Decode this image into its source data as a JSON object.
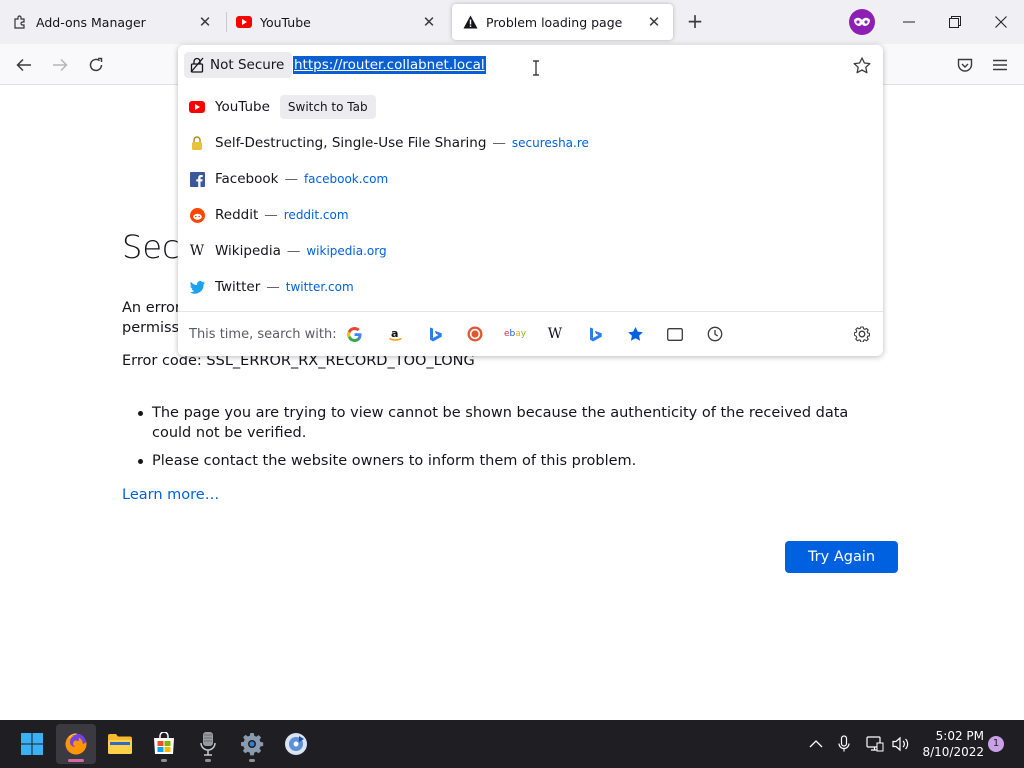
{
  "tabs": [
    {
      "title": "Add-ons Manager",
      "icon": "puzzle-icon",
      "active": false
    },
    {
      "title": "YouTube",
      "icon": "youtube-icon",
      "active": false
    },
    {
      "title": "Problem loading page",
      "icon": "warning-icon",
      "active": true
    }
  ],
  "urlbar": {
    "security_label": "Not Secure",
    "url": "https://router.collabnet.local"
  },
  "suggestions": [
    {
      "title": "YouTube",
      "action": "Switch to Tab",
      "url": "",
      "icon": "youtube-icon"
    },
    {
      "title": "Self-Destructing, Single-Use File Sharing",
      "url": "securesha.re",
      "icon": "lock-icon"
    },
    {
      "title": "Facebook",
      "url": "facebook.com",
      "icon": "facebook-icon"
    },
    {
      "title": "Reddit",
      "url": "reddit.com",
      "icon": "reddit-icon"
    },
    {
      "title": "Wikipedia",
      "url": "wikipedia.org",
      "icon": "wikipedia-icon"
    },
    {
      "title": "Twitter",
      "url": "twitter.com",
      "icon": "twitter-icon"
    }
  ],
  "search_with_label": "This time, search with:",
  "search_engines": [
    "google-icon",
    "amazon-icon",
    "bing-icon",
    "duckduckgo-icon",
    "ebay-icon",
    "wikipedia-icon",
    "bing-icon",
    "bookmarks-icon",
    "tabs-icon",
    "history-icon"
  ],
  "dash": "—",
  "error": {
    "title_visible": "Secu",
    "desc_line1": "An error",
    "desc_line2": "permissi",
    "code": "Error code: SSL_ERROR_RX_RECORD_TOO_LONG",
    "bullets": [
      "The page you are trying to view cannot be shown because the authenticity of the received data could not be verified.",
      "Please contact the website owners to inform them of this problem."
    ],
    "learn_more": "Learn more…",
    "try_again": "Try Again"
  },
  "taskbar": {
    "apps": [
      "windows-start-icon",
      "firefox-icon",
      "file-explorer-icon",
      "microsoft-store-icon",
      "microphone-app-icon",
      "settings-icon",
      "media-player-icon"
    ],
    "time": "5:02 PM",
    "date": "8/10/2022",
    "notifications": "1"
  },
  "colors": {
    "accent": "#0061e0",
    "selection": "#0a5fd1",
    "private": "#8d1fb5",
    "youtube": "#ff0000"
  }
}
